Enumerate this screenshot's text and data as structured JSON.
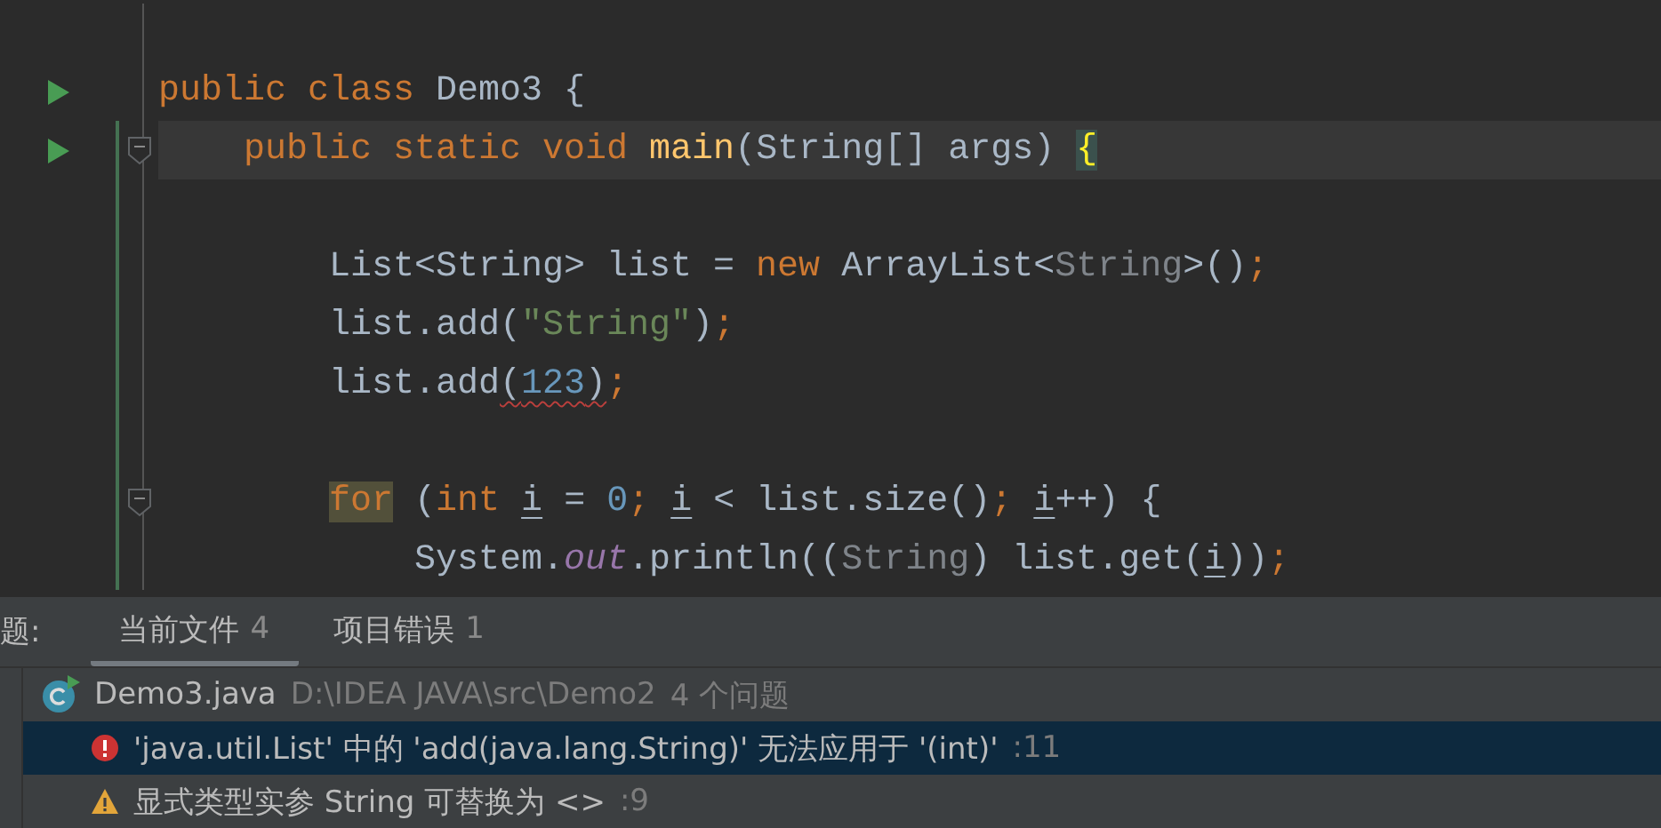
{
  "editor": {
    "lines": [
      {
        "run": false,
        "fold": false,
        "current": false,
        "changed": false
      },
      {
        "kind": "class",
        "run": true,
        "fold": false,
        "current": false,
        "changed": false,
        "tokens": [
          {
            "t": "public ",
            "kind": "kw"
          },
          {
            "t": "class ",
            "kind": "kw"
          },
          {
            "t": "Demo3 {",
            "kind": "plain"
          }
        ]
      },
      {
        "kind": "member",
        "run": true,
        "fold": true,
        "current": true,
        "changed": true,
        "tokens": [
          {
            "t": "public static void ",
            "kind": "kw"
          },
          {
            "t": "main",
            "kind": "method"
          },
          {
            "t": "(String[] args) ",
            "kind": "plain"
          },
          {
            "t": "{",
            "kind": "brace"
          }
        ]
      },
      {
        "run": false,
        "fold": false,
        "current": false,
        "changed": true
      },
      {
        "kind": "statement",
        "run": false,
        "fold": false,
        "current": false,
        "changed": true,
        "tokens": [
          {
            "t": "List<String> list = ",
            "kind": "plain"
          },
          {
            "t": "new ",
            "kind": "kw"
          },
          {
            "t": "ArrayList<",
            "kind": "plain"
          },
          {
            "t": "String",
            "kind": "muted"
          },
          {
            "t": ">()",
            "kind": "plain"
          },
          {
            "t": ";",
            "kind": "punct"
          }
        ]
      },
      {
        "kind": "statement",
        "run": false,
        "fold": false,
        "current": false,
        "changed": true,
        "tokens": [
          {
            "t": "list.add(",
            "kind": "plain"
          },
          {
            "t": "\"String\"",
            "kind": "str"
          },
          {
            "t": ")",
            "kind": "plain"
          },
          {
            "t": ";",
            "kind": "punct"
          }
        ]
      },
      {
        "kind": "statement",
        "run": false,
        "fold": false,
        "current": false,
        "changed": true,
        "tokens": [
          {
            "t": "list.add",
            "kind": "plain"
          },
          {
            "t": "(",
            "kind": "plain",
            "squiggle": true
          },
          {
            "t": "123",
            "kind": "num",
            "squiggle": true
          },
          {
            "t": ")",
            "kind": "plain",
            "squiggle": true
          },
          {
            "t": ";",
            "kind": "punct"
          }
        ]
      },
      {
        "run": false,
        "fold": false,
        "current": false,
        "changed": true
      },
      {
        "kind": "statement",
        "run": false,
        "fold": true,
        "current": false,
        "changed": true,
        "tokens": [
          {
            "t": "for",
            "kind": "kwhl"
          },
          {
            "t": " (",
            "kind": "plain"
          },
          {
            "t": "int ",
            "kind": "kw"
          },
          {
            "t": "i",
            "kind": "var"
          },
          {
            "t": " = ",
            "kind": "plain"
          },
          {
            "t": "0",
            "kind": "num"
          },
          {
            "t": "; ",
            "kind": "punct"
          },
          {
            "t": "i",
            "kind": "var"
          },
          {
            "t": " < list.size()",
            "kind": "plain"
          },
          {
            "t": "; ",
            "kind": "punct"
          },
          {
            "t": "i",
            "kind": "var"
          },
          {
            "t": "++) {",
            "kind": "plain"
          }
        ]
      },
      {
        "kind": "nested",
        "run": false,
        "fold": false,
        "current": false,
        "changed": true,
        "tokens": [
          {
            "t": "System.",
            "kind": "plain"
          },
          {
            "t": "out",
            "kind": "field"
          },
          {
            "t": ".println((",
            "kind": "plain"
          },
          {
            "t": "String",
            "kind": "muted"
          },
          {
            "t": ") list.get(",
            "kind": "plain"
          },
          {
            "t": "i",
            "kind": "var"
          },
          {
            "t": "))",
            "kind": "plain"
          },
          {
            "t": ";",
            "kind": "punct"
          }
        ]
      }
    ]
  },
  "problems": {
    "title": "题:",
    "tabs": [
      {
        "label": "当前文件",
        "count": "4",
        "selected": true
      },
      {
        "label": "项目错误",
        "count": "1",
        "selected": false
      }
    ],
    "file": {
      "name": "Demo3.java",
      "path": "D:\\IDEA JAVA\\src\\Demo2",
      "count": "4 个问题"
    },
    "items": [
      {
        "kind": "error",
        "message": "'java.util.List' 中的 'add(java.lang.String)' 无法应用于 '(int)'",
        "line": ":11",
        "selected": true
      },
      {
        "kind": "warning",
        "message": "显式类型实参 String 可替换为 <>",
        "line": ":9",
        "selected": false
      }
    ]
  }
}
